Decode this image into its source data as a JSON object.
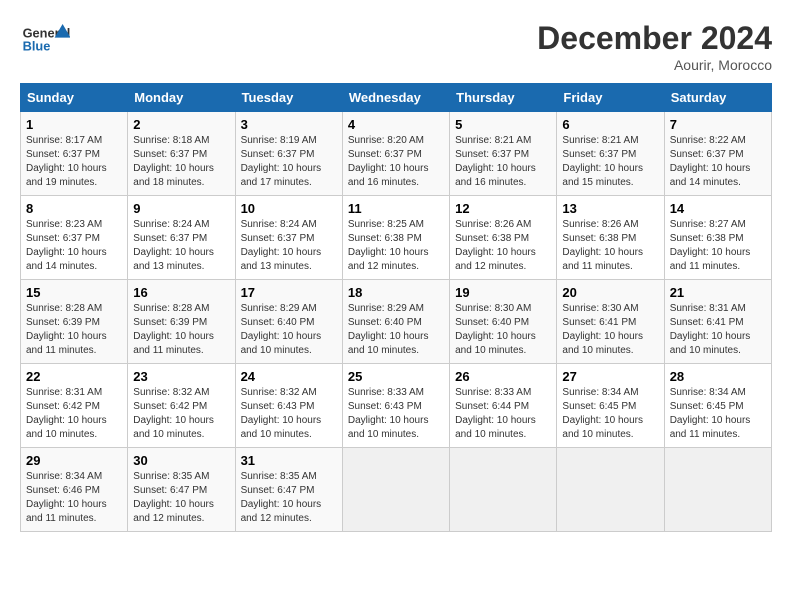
{
  "header": {
    "logo_line1": "General",
    "logo_line2": "Blue",
    "month_title": "December 2024",
    "location": "Aourir, Morocco"
  },
  "weekdays": [
    "Sunday",
    "Monday",
    "Tuesday",
    "Wednesday",
    "Thursday",
    "Friday",
    "Saturday"
  ],
  "days": [
    {
      "num": "",
      "empty": true
    },
    {
      "num": "1",
      "sunrise": "8:17 AM",
      "sunset": "6:37 PM",
      "daylight": "10 hours and 19 minutes."
    },
    {
      "num": "2",
      "sunrise": "8:18 AM",
      "sunset": "6:37 PM",
      "daylight": "10 hours and 18 minutes."
    },
    {
      "num": "3",
      "sunrise": "8:19 AM",
      "sunset": "6:37 PM",
      "daylight": "10 hours and 17 minutes."
    },
    {
      "num": "4",
      "sunrise": "8:20 AM",
      "sunset": "6:37 PM",
      "daylight": "10 hours and 16 minutes."
    },
    {
      "num": "5",
      "sunrise": "8:21 AM",
      "sunset": "6:37 PM",
      "daylight": "10 hours and 16 minutes."
    },
    {
      "num": "6",
      "sunrise": "8:21 AM",
      "sunset": "6:37 PM",
      "daylight": "10 hours and 15 minutes."
    },
    {
      "num": "7",
      "sunrise": "8:22 AM",
      "sunset": "6:37 PM",
      "daylight": "10 hours and 14 minutes."
    },
    {
      "num": "8",
      "sunrise": "8:23 AM",
      "sunset": "6:37 PM",
      "daylight": "10 hours and 14 minutes."
    },
    {
      "num": "9",
      "sunrise": "8:24 AM",
      "sunset": "6:37 PM",
      "daylight": "10 hours and 13 minutes."
    },
    {
      "num": "10",
      "sunrise": "8:24 AM",
      "sunset": "6:37 PM",
      "daylight": "10 hours and 13 minutes."
    },
    {
      "num": "11",
      "sunrise": "8:25 AM",
      "sunset": "6:38 PM",
      "daylight": "10 hours and 12 minutes."
    },
    {
      "num": "12",
      "sunrise": "8:26 AM",
      "sunset": "6:38 PM",
      "daylight": "10 hours and 12 minutes."
    },
    {
      "num": "13",
      "sunrise": "8:26 AM",
      "sunset": "6:38 PM",
      "daylight": "10 hours and 11 minutes."
    },
    {
      "num": "14",
      "sunrise": "8:27 AM",
      "sunset": "6:38 PM",
      "daylight": "10 hours and 11 minutes."
    },
    {
      "num": "15",
      "sunrise": "8:28 AM",
      "sunset": "6:39 PM",
      "daylight": "10 hours and 11 minutes."
    },
    {
      "num": "16",
      "sunrise": "8:28 AM",
      "sunset": "6:39 PM",
      "daylight": "10 hours and 11 minutes."
    },
    {
      "num": "17",
      "sunrise": "8:29 AM",
      "sunset": "6:40 PM",
      "daylight": "10 hours and 10 minutes."
    },
    {
      "num": "18",
      "sunrise": "8:29 AM",
      "sunset": "6:40 PM",
      "daylight": "10 hours and 10 minutes."
    },
    {
      "num": "19",
      "sunrise": "8:30 AM",
      "sunset": "6:40 PM",
      "daylight": "10 hours and 10 minutes."
    },
    {
      "num": "20",
      "sunrise": "8:30 AM",
      "sunset": "6:41 PM",
      "daylight": "10 hours and 10 minutes."
    },
    {
      "num": "21",
      "sunrise": "8:31 AM",
      "sunset": "6:41 PM",
      "daylight": "10 hours and 10 minutes."
    },
    {
      "num": "22",
      "sunrise": "8:31 AM",
      "sunset": "6:42 PM",
      "daylight": "10 hours and 10 minutes."
    },
    {
      "num": "23",
      "sunrise": "8:32 AM",
      "sunset": "6:42 PM",
      "daylight": "10 hours and 10 minutes."
    },
    {
      "num": "24",
      "sunrise": "8:32 AM",
      "sunset": "6:43 PM",
      "daylight": "10 hours and 10 minutes."
    },
    {
      "num": "25",
      "sunrise": "8:33 AM",
      "sunset": "6:43 PM",
      "daylight": "10 hours and 10 minutes."
    },
    {
      "num": "26",
      "sunrise": "8:33 AM",
      "sunset": "6:44 PM",
      "daylight": "10 hours and 10 minutes."
    },
    {
      "num": "27",
      "sunrise": "8:34 AM",
      "sunset": "6:45 PM",
      "daylight": "10 hours and 10 minutes."
    },
    {
      "num": "28",
      "sunrise": "8:34 AM",
      "sunset": "6:45 PM",
      "daylight": "10 hours and 11 minutes."
    },
    {
      "num": "29",
      "sunrise": "8:34 AM",
      "sunset": "6:46 PM",
      "daylight": "10 hours and 11 minutes."
    },
    {
      "num": "30",
      "sunrise": "8:35 AM",
      "sunset": "6:47 PM",
      "daylight": "10 hours and 12 minutes."
    },
    {
      "num": "31",
      "sunrise": "8:35 AM",
      "sunset": "6:47 PM",
      "daylight": "10 hours and 12 minutes."
    }
  ]
}
